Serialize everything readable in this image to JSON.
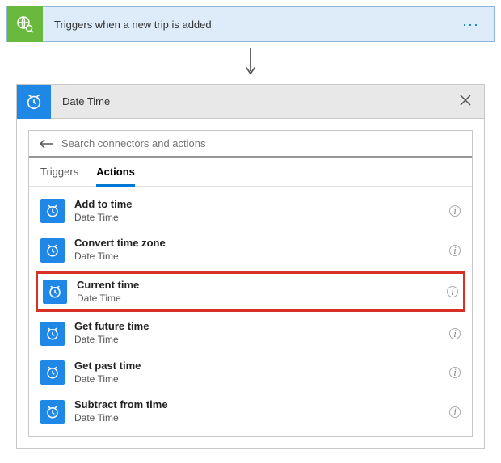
{
  "trigger": {
    "title": "Triggers when a new trip is added"
  },
  "panel": {
    "title": "Date Time",
    "search_placeholder": "Search connectors and actions"
  },
  "tabs": {
    "triggers": "Triggers",
    "actions": "Actions"
  },
  "actions": [
    {
      "title": "Add to time",
      "sub": "Date Time"
    },
    {
      "title": "Convert time zone",
      "sub": "Date Time"
    },
    {
      "title": "Current time",
      "sub": "Date Time"
    },
    {
      "title": "Get future time",
      "sub": "Date Time"
    },
    {
      "title": "Get past time",
      "sub": "Date Time"
    },
    {
      "title": "Subtract from time",
      "sub": "Date Time"
    }
  ]
}
